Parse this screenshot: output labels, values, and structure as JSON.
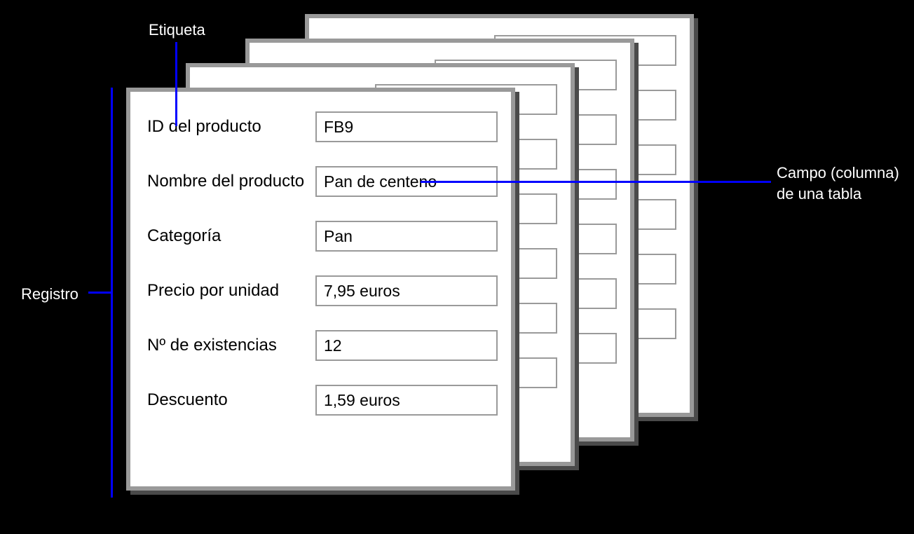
{
  "form": {
    "fields": [
      {
        "label": "ID del producto",
        "value": "FB9"
      },
      {
        "label": "Nombre del producto",
        "value": "Pan de centeno"
      },
      {
        "label": "Categoría",
        "value": "Pan"
      },
      {
        "label": "Precio por unidad",
        "value": "7,95 euros"
      },
      {
        "label": "Nº de existencias",
        "value": "12"
      },
      {
        "label": "Descuento",
        "value": "1,59 euros"
      }
    ]
  },
  "callouts": {
    "top": "Etiqueta",
    "left": "Registro",
    "right_line1": "Campo (columna)",
    "right_line2": "de una tabla"
  },
  "colors": {
    "callout_line": "#0000ff",
    "card_border": "#999999",
    "shadow": "#4a4a4a"
  }
}
